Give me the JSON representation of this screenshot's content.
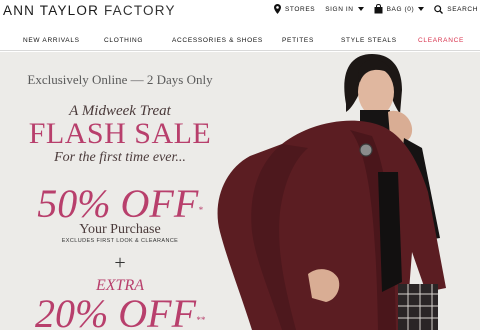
{
  "header": {
    "logo_primary": "ANN TAYLOR",
    "logo_secondary": "FACTORY",
    "stores_label": "STORES",
    "signin_label": "SIGN IN",
    "bag_label": "BAG (0)",
    "search_label": "SEARCH"
  },
  "nav": {
    "items": [
      {
        "label": "NEW ARRIVALS"
      },
      {
        "label": "CLOTHING"
      },
      {
        "label": "ACCESSORIES & SHOES"
      },
      {
        "label": "PETITES"
      },
      {
        "label": "STYLE STEALS"
      },
      {
        "label": "CLEARANCE"
      }
    ]
  },
  "hero": {
    "tagline": "Exclusively Online — 2 Days Only",
    "subhead": "A Midweek Treat",
    "headline": "FLASH SALE",
    "first_time": "For the first time ever...",
    "offer1_value": "50% OFF",
    "offer1_mark": "*",
    "offer1_desc": "Your Purchase",
    "excludes": "EXCLUDES FIRST LOOK & CLEARANCE",
    "plus": "+",
    "extra_label": "EXTRA",
    "offer2_value": "20% OFF",
    "offer2_mark": "**"
  },
  "colors": {
    "accent": "#b83f6c",
    "clearance": "#d8324c",
    "hero_bg": "#ecebe8",
    "coat": "#5b1d22"
  },
  "icons": [
    "map-pin-icon",
    "caret-down-icon",
    "bag-icon",
    "search-icon"
  ]
}
